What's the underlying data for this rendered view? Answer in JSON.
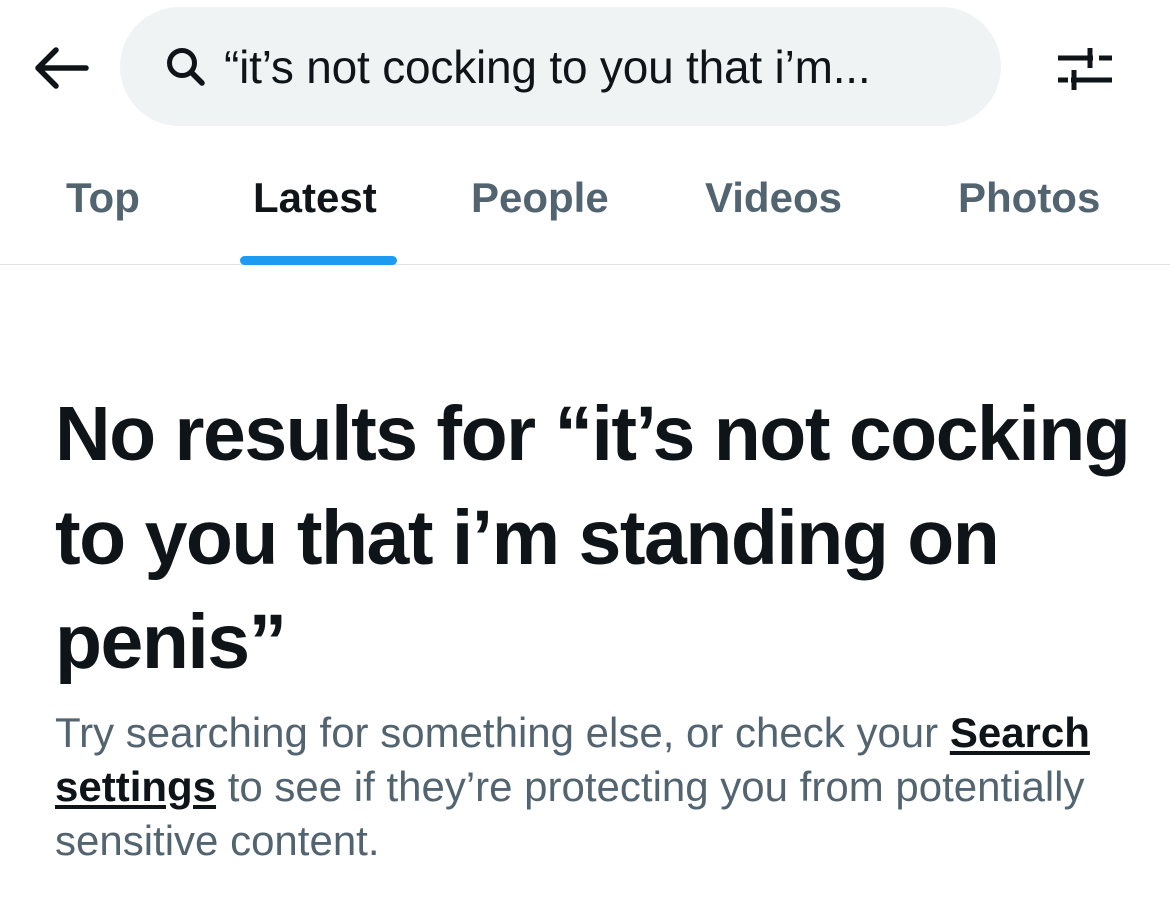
{
  "header": {
    "back_icon": "arrow-left-icon",
    "search": {
      "icon": "search-icon",
      "query": "“it’s not cocking to you that i’m..."
    },
    "filter_icon": "sliders-icon"
  },
  "tabs": [
    {
      "label": "Top",
      "active": false
    },
    {
      "label": "Latest",
      "active": true
    },
    {
      "label": "People",
      "active": false
    },
    {
      "label": "Videos",
      "active": false
    },
    {
      "label": "Photos",
      "active": false
    }
  ],
  "empty_state": {
    "title": "No results for “it’s not cocking to you that i’m standing on penis”",
    "desc_before": "Try searching for something else, or check your ",
    "settings_link": "Search settings",
    "desc_after": " to see if they’re protecting you from potentially sensitive content."
  },
  "colors": {
    "accent": "#1d9bf0",
    "primary_text": "#0f1419",
    "secondary_text": "#536471",
    "search_bg": "#eff3f4"
  }
}
